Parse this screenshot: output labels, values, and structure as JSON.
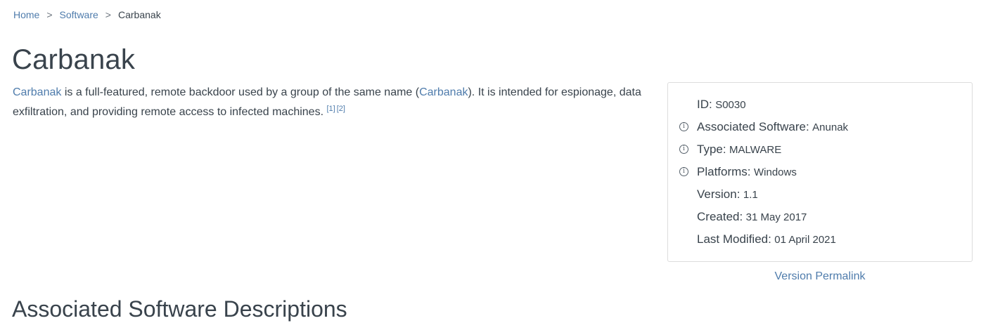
{
  "breadcrumb": {
    "home": "Home",
    "software": "Software",
    "current": "Carbanak",
    "separator": ">"
  },
  "title": "Carbanak",
  "description": {
    "link1": "Carbanak",
    "text1": " is a full-featured, remote backdoor used by a group of the same name (",
    "link2": "Carbanak",
    "text2": "). It is intended for espionage, data exfiltration, and providing remote access to infected machines. ",
    "ref1": "[1]",
    "ref2": "[2]"
  },
  "card": {
    "info_glyph": "i",
    "id": {
      "label": "ID:",
      "value": "S0030"
    },
    "associated": {
      "label": "Associated Software:",
      "value": "Anunak",
      "icon": "info-icon"
    },
    "type": {
      "label": "Type:",
      "value": "MALWARE",
      "icon": "info-icon"
    },
    "platforms": {
      "label": "Platforms:",
      "value": "Windows",
      "icon": "info-icon"
    },
    "version": {
      "label": "Version:",
      "value": "1.1"
    },
    "created": {
      "label": "Created:",
      "value": "31 May 2017"
    },
    "modified": {
      "label": "Last Modified:",
      "value": "01 April 2021"
    }
  },
  "permalink": "Version Permalink",
  "section_title": "Associated Software Descriptions",
  "colors": {
    "link": "#4f7cac",
    "text": "#39434c",
    "border": "#dcdcdc"
  }
}
